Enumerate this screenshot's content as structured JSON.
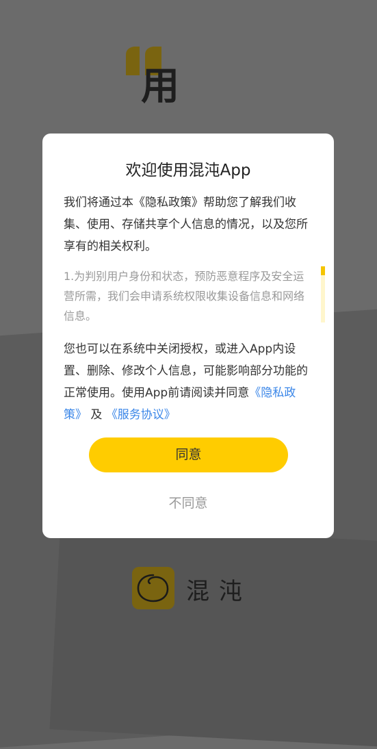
{
  "colors": {
    "accent": "#ffcc00",
    "link": "#3a86e8",
    "overlay": "#6b6b6b",
    "logo_gold": "#7a6410"
  },
  "splash": {
    "char": "用"
  },
  "dialog": {
    "title": "欢迎使用混沌App",
    "intro": "我们将通过本《隐私政策》帮助您了解我们收集、使用、存储共享个人信息的情况，以及您所享有的相关权利。",
    "scroll_text": "1.为判别用户身份和状态，预防恶意程序及安全运营所需，我们会申请系统权限收集设备信息和网络信息。",
    "outro_prefix": "您也可以在系统中关闭授权，或进入App内设置、删除、修改个人信息，可能影响部分功能的正常使用。使用App前请阅读并同意",
    "privacy_link": "《隐私政策》",
    "and_text": " 及 ",
    "terms_link": "《服务协议》",
    "agree_label": "同意",
    "disagree_label": "不同意"
  },
  "brand": {
    "logo_icon": "circle-logo-icon",
    "name": "混沌"
  }
}
